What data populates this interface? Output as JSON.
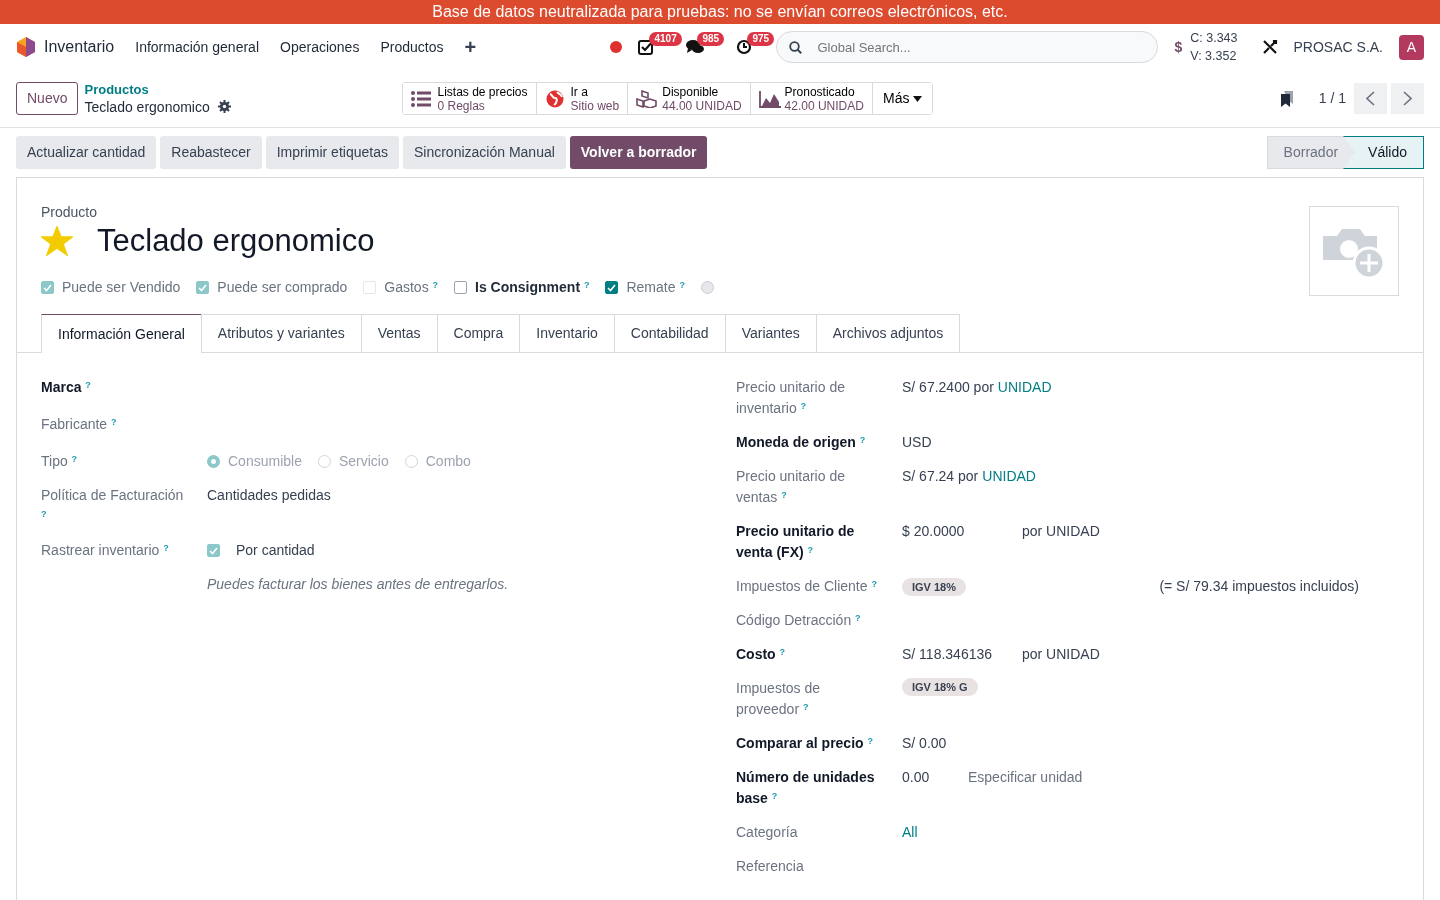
{
  "banner": "Base de datos neutralizada para pruebas: no se envían correos electrónicos, etc.",
  "navbar": {
    "app_name": "Inventario",
    "menu": [
      "Información general",
      "Operaciones",
      "Productos"
    ],
    "new_symbol": "+",
    "systray": [
      {
        "kind": "activity",
        "count": "4107"
      },
      {
        "kind": "messages",
        "count": "985"
      },
      {
        "kind": "clock",
        "count": "975"
      }
    ],
    "search_placeholder": "Global Search...",
    "currency_symbol": "$",
    "rates": [
      "C: 3.343",
      "V: 3.352"
    ],
    "company": "PROSAC S.A.",
    "avatar": "A"
  },
  "control_panel": {
    "new_button": "Nuevo",
    "breadcrumb_parent": "Productos",
    "breadcrumb_current": "Teclado ergonomico",
    "smart_buttons": [
      {
        "kind": "list",
        "label": "Listas de precios",
        "value": "0 Reglas"
      },
      {
        "kind": "globe",
        "label": "Ir a",
        "value": "Sitio web"
      },
      {
        "kind": "boxes",
        "label": "Disponible",
        "value": "44.00 UNIDAD"
      },
      {
        "kind": "area",
        "label": "Pronosticado",
        "value": "42.00 UNIDAD"
      }
    ],
    "more": "Más",
    "pager": "1 / 1"
  },
  "actions": [
    {
      "label": "Actualizar cantidad",
      "kind": "secondary"
    },
    {
      "label": "Reabastecer",
      "kind": "secondary"
    },
    {
      "label": "Imprimir etiquetas",
      "kind": "secondary"
    },
    {
      "label": "Sincronización Manual",
      "kind": "secondary"
    },
    {
      "label": "Volver a borrador",
      "kind": "primary"
    }
  ],
  "statusbar": [
    {
      "label": "Borrador",
      "selected": false
    },
    {
      "label": "Válido",
      "selected": true
    }
  ],
  "form": {
    "type_label": "Producto",
    "title": "Teclado ergonomico",
    "starred": true,
    "options": [
      {
        "kind": "checkbox",
        "label": "Puede ser Vendido",
        "checked": true,
        "readonly": true,
        "emphasis": false
      },
      {
        "kind": "checkbox",
        "label": "Puede ser comprado",
        "checked": true,
        "readonly": true,
        "emphasis": false
      },
      {
        "kind": "checkbox",
        "label": "Gastos $^{?}$",
        "checked": false,
        "readonly": true,
        "emphasis": false
      },
      {
        "kind": "checkbox",
        "label": "Is Consignment $^{?}$",
        "checked": false,
        "readonly": false,
        "emphasis": true
      },
      {
        "kind": "checkbox",
        "label": "Remate $^{?}$",
        "checked": true,
        "readonly": false,
        "emphasis": false
      },
      {
        "kind": "radio",
        "checked": false
      }
    ],
    "tabs": [
      {
        "label": "Información General",
        "selected": true
      },
      {
        "label": "Atributos y variantes",
        "selected": false
      },
      {
        "label": "Ventas",
        "selected": false
      },
      {
        "label": "Compra",
        "selected": false
      },
      {
        "label": "Inventario",
        "selected": false
      },
      {
        "label": "Contabilidad",
        "selected": false
      },
      {
        "label": "Variantes",
        "selected": false
      },
      {
        "label": "Archivos adjuntos",
        "selected": false
      }
    ],
    "left_fields": [
      {
        "label": "Marca $^{?}$",
        "bold": true,
        "kind": "empty"
      },
      {
        "label": "Fabricante $^{?}$",
        "bold": false,
        "kind": "empty"
      },
      {
        "label": "Tipo $^{?}$",
        "bold": false,
        "kind": "radio",
        "options": [
          {
            "label": "Consumible",
            "selected": true
          },
          {
            "label": "Servicio",
            "selected": false
          },
          {
            "label": "Combo",
            "selected": false
          }
        ]
      },
      {
        "label": "Política de Facturación $^{?}$",
        "bold": false,
        "kind": "text",
        "value": "Cantidades pedidas"
      },
      {
        "label": "Rastrear inventario $^{?}$",
        "bold": false,
        "kind": "checkbox",
        "checked": true,
        "value": "Por cantidad"
      },
      {
        "kind": "note",
        "value": "Puedes facturar los bienes antes de entregarlos."
      }
    ],
    "right_fields": [
      {
        "label": "Precio unitario de inventario $^{?}$",
        "bold": false,
        "parts": [
          {
            "kind": "text",
            "text": "S/ 67.2400 por"
          },
          {
            "kind": "link",
            "text": "UNIDAD"
          }
        ]
      },
      {
        "label": "Moneda de origen $^{?}$",
        "bold": true,
        "parts": [
          {
            "kind": "text",
            "text": "USD"
          }
        ]
      },
      {
        "label": "Precio unitario de ventas $^{?}$",
        "bold": false,
        "parts": [
          {
            "kind": "text",
            "text": "S/ 67.24 por"
          },
          {
            "kind": "link",
            "text": "UNIDAD"
          }
        ]
      },
      {
        "label": "Precio unitario de venta (FX) $^{?}$",
        "bold": true,
        "parts": [
          {
            "kind": "amount",
            "text": "$ 20.0000"
          },
          {
            "kind": "text",
            "text": "por UNIDAD"
          }
        ]
      },
      {
        "label": "Impuestos de Cliente $^{?}$",
        "bold": false,
        "parts": [
          {
            "kind": "tag",
            "text": "IGV 18%"
          },
          {
            "kind": "note",
            "text": "(= S/ 79.34 impuestos incluidos)"
          }
        ]
      },
      {
        "label": "Código Detracción $^{?}$",
        "bold": false
      },
      {
        "label": "Costo $^{?}$",
        "bold": true,
        "parts": [
          {
            "kind": "amount",
            "text": "S/ 118.346136"
          },
          {
            "kind": "text",
            "text": "por UNIDAD"
          }
        ]
      },
      {
        "label": "Impuestos de proveedor $^{?}$",
        "bold": false,
        "parts": [
          {
            "kind": "tag",
            "text": "IGV 18% G"
          }
        ]
      },
      {
        "label": "Comparar al precio $^{?}$",
        "bold": true,
        "parts": [
          {
            "kind": "text",
            "text": "S/ 0.00"
          }
        ]
      },
      {
        "label": "Número de unidades base $^{?}$",
        "bold": true,
        "parts": [
          {
            "kind": "qty",
            "text": "0.00"
          },
          {
            "kind": "muted",
            "text": "Especificar unidad"
          }
        ]
      },
      {
        "label": "Categoría",
        "bold": false,
        "parts": [
          {
            "kind": "link",
            "text": "All"
          }
        ]
      },
      {
        "label": "Referencia",
        "bold": false
      }
    ]
  }
}
